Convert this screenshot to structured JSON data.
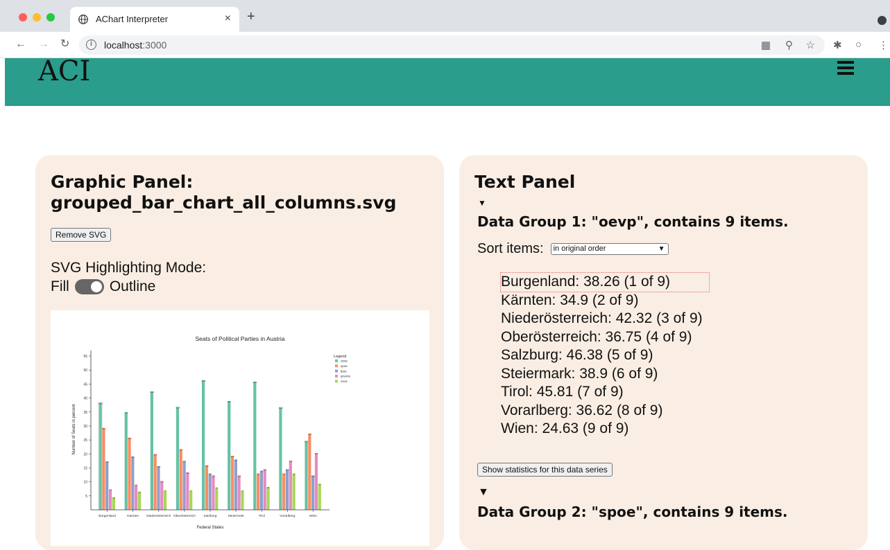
{
  "browser": {
    "tab_title": "AChart Interpreter",
    "tab_close": "×",
    "new_tab": "+",
    "url_host": "localhost",
    "url_port": ":3000"
  },
  "app": {
    "title": "ACI"
  },
  "graphic_panel": {
    "heading_line1": "Graphic Panel:",
    "heading_line2": "grouped_bar_chart_all_columns.svg",
    "remove_button": "Remove SVG",
    "mode_label": "SVG Highlighting Mode:",
    "mode_fill": "Fill",
    "mode_outline": "Outline"
  },
  "text_panel": {
    "heading": "Text Panel",
    "group1_title": "Data Group 1: \"oevp\", contains 9 items.",
    "sort_label": "Sort items:",
    "sort_value": "in original order",
    "items": [
      "Burgenland: 38.26 (1 of 9)",
      "Kärnten: 34.9 (2 of 9)",
      "Niederösterreich: 42.32 (3 of 9)",
      "Oberösterreich: 36.75 (4 of 9)",
      "Salzburg: 46.38 (5 of 9)",
      "Steiermark: 38.9 (6 of 9)",
      "Tirol: 45.81 (7 of 9)",
      "Vorarlberg: 36.62 (8 of 9)",
      "Wien: 24.63 (9 of 9)"
    ],
    "stats_button": "Show statistics for this data series",
    "group2_title": "Data Group 2: \"spoe\", contains 9 items."
  },
  "chart_data": {
    "type": "bar",
    "title": "Seats of Political Parties in Austria",
    "xlabel": "Federal States",
    "ylabel": "Number of Seats in percent",
    "ylim": [
      0,
      57
    ],
    "yticks": [
      "5",
      "10",
      "15",
      "20",
      "25",
      "30",
      "35",
      "40",
      "45",
      "50",
      "55"
    ],
    "legend_title": "Legend",
    "categories": [
      "Burgenland",
      "Kärnten",
      "Niederösterreich",
      "Oberösterreich",
      "Salzburg",
      "Steiermark",
      "Tirol",
      "Vorarlberg",
      "Wien"
    ],
    "series": [
      {
        "name": "oevp",
        "color": "#66c2a5",
        "values": [
          38.26,
          34.9,
          42.32,
          36.75,
          46.38,
          38.9,
          45.81,
          36.62,
          24.63
        ]
      },
      {
        "name": "spoe",
        "color": "#fc8d62",
        "values": [
          29.3,
          25.8,
          19.9,
          21.7,
          15.9,
          19.3,
          13.0,
          13.0,
          27.3
        ]
      },
      {
        "name": "fpoe",
        "color": "#8da0cb",
        "values": [
          17.3,
          19.1,
          15.6,
          17.5,
          13.0,
          18.0,
          14.0,
          14.5,
          12.3
        ]
      },
      {
        "name": "gruene",
        "color": "#e78ac3",
        "values": [
          7.3,
          9.0,
          10.3,
          13.4,
          12.3,
          12.3,
          14.5,
          17.6,
          20.3
        ]
      },
      {
        "name": "neos",
        "color": "#a6d854",
        "values": [
          4.5,
          6.5,
          7.0,
          7.0,
          8.0,
          7.0,
          8.2,
          13.0,
          9.3
        ]
      }
    ],
    "legend_position": "top-right"
  }
}
